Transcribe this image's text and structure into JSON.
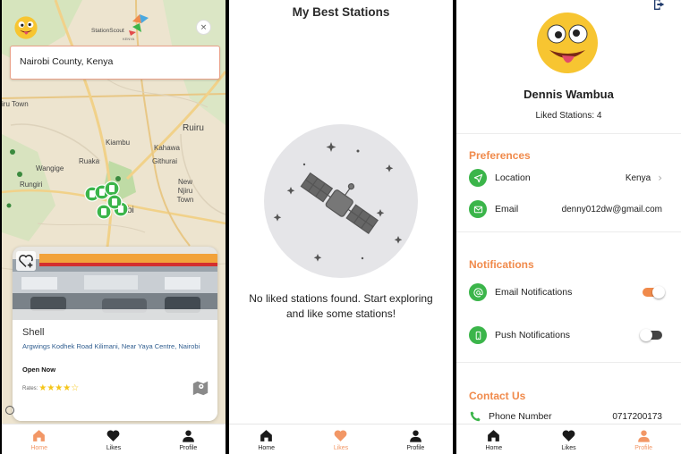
{
  "map_screen": {
    "brand_name": "StationScout",
    "brand_tagline": "KENYA",
    "close_symbol": "×",
    "search_value": "Nairobi County, Kenya",
    "map_places": [
      "Ruiru",
      "Kiambu",
      "Kahawa",
      "Githurai",
      "Ruaka",
      "Wangige",
      "Rungiri",
      "New Njiru Town",
      "iru Town",
      "bi"
    ],
    "station_card": {
      "name": "Shell",
      "address": "Argwings Kodhek Road Kilimani, Near Yaya Centre, Nairobi",
      "status": "Open Now",
      "rates_label": "Rates:",
      "rating": 4,
      "rating_max": 5
    }
  },
  "likes_screen": {
    "title": "My Best Stations",
    "empty_message": "No liked stations found. Start exploring and like some stations!"
  },
  "profile_screen": {
    "name": "Dennis Wambua",
    "liked_stations": "Liked Stations: 4",
    "preferences": {
      "title": "Preferences",
      "location_label": "Location",
      "location_value": "Kenya",
      "email_label": "Email",
      "email_value": "denny012dw@gmail.com"
    },
    "notifications": {
      "title": "Notifications",
      "email_label": "Email Notifications",
      "email_enabled": true,
      "push_label": "Push Notifications",
      "push_enabled": false
    },
    "contact": {
      "title": "Contact Us",
      "phone_label": "Phone Number",
      "phone_value": "0717200173"
    }
  },
  "nav": {
    "home": "Home",
    "likes": "Likes",
    "profile": "Profile"
  },
  "colors": {
    "accent": "#f08a4b",
    "green": "#3bb54a",
    "link": "#2f5d8f",
    "star": "#f5c518"
  },
  "icons": [
    "home-icon",
    "heart-icon",
    "person-icon",
    "location-arrow-icon",
    "envelope-icon",
    "at-icon",
    "phone-icon",
    "logout-icon",
    "satellite-icon",
    "map-icon",
    "heart-plus-icon"
  ]
}
